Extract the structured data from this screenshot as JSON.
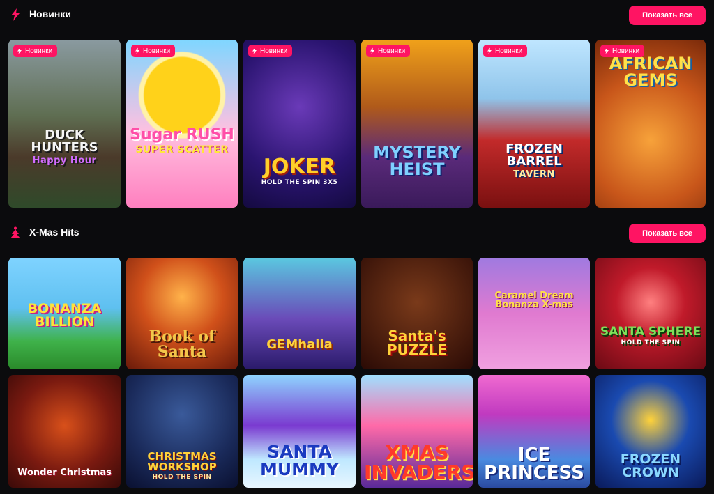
{
  "sections": [
    {
      "title": "Новинки",
      "icon": "lightning-icon",
      "show_all": "Показать все",
      "games": [
        {
          "name": "DUCK HUNTERS",
          "sub": "Happy Hour",
          "badge": "Новинки"
        },
        {
          "name": "Sugar RUSH",
          "sub": "SUPER SCATTER",
          "badge": "Новинки"
        },
        {
          "name": "JOKER",
          "sub": "HOLD THE SPIN 3x5",
          "badge": "Новинки"
        },
        {
          "name": "MYSTERY HEIST",
          "sub": "",
          "badge": "Новинки"
        },
        {
          "name": "FROZEN BARREL",
          "sub": "TAVERN",
          "badge": "Новинки"
        },
        {
          "name": "AFRICAN GEMS",
          "sub": "",
          "badge": "Новинки"
        }
      ]
    },
    {
      "title": "X-Mas Hits",
      "icon": "christmas-tree-icon",
      "show_all": "Показать все",
      "games": [
        {
          "name": "BONANZA BILLION",
          "sub": ""
        },
        {
          "name": "Book of Santa",
          "sub": ""
        },
        {
          "name": "GEMhalla",
          "sub": ""
        },
        {
          "name": "Santa's PUZZLE",
          "sub": ""
        },
        {
          "name": "Caramel Dream Bonanza X-mas",
          "sub": ""
        },
        {
          "name": "SANTA SPHERE",
          "sub": "HOLD THE SPIN"
        },
        {
          "name": "Wonder Christmas",
          "sub": ""
        },
        {
          "name": "CHRISTMAS WORKSHOP",
          "sub": "HOLD THE SPIN"
        },
        {
          "name": "SANTA MUMMY",
          "sub": ""
        },
        {
          "name": "XMAS INVADERS",
          "sub": ""
        },
        {
          "name": "ICE PRINCESS",
          "sub": ""
        },
        {
          "name": "FROZEN CROWN",
          "sub": ""
        }
      ]
    }
  ],
  "colors": {
    "accent": "#ff1463",
    "background": "#0b0b0d"
  }
}
